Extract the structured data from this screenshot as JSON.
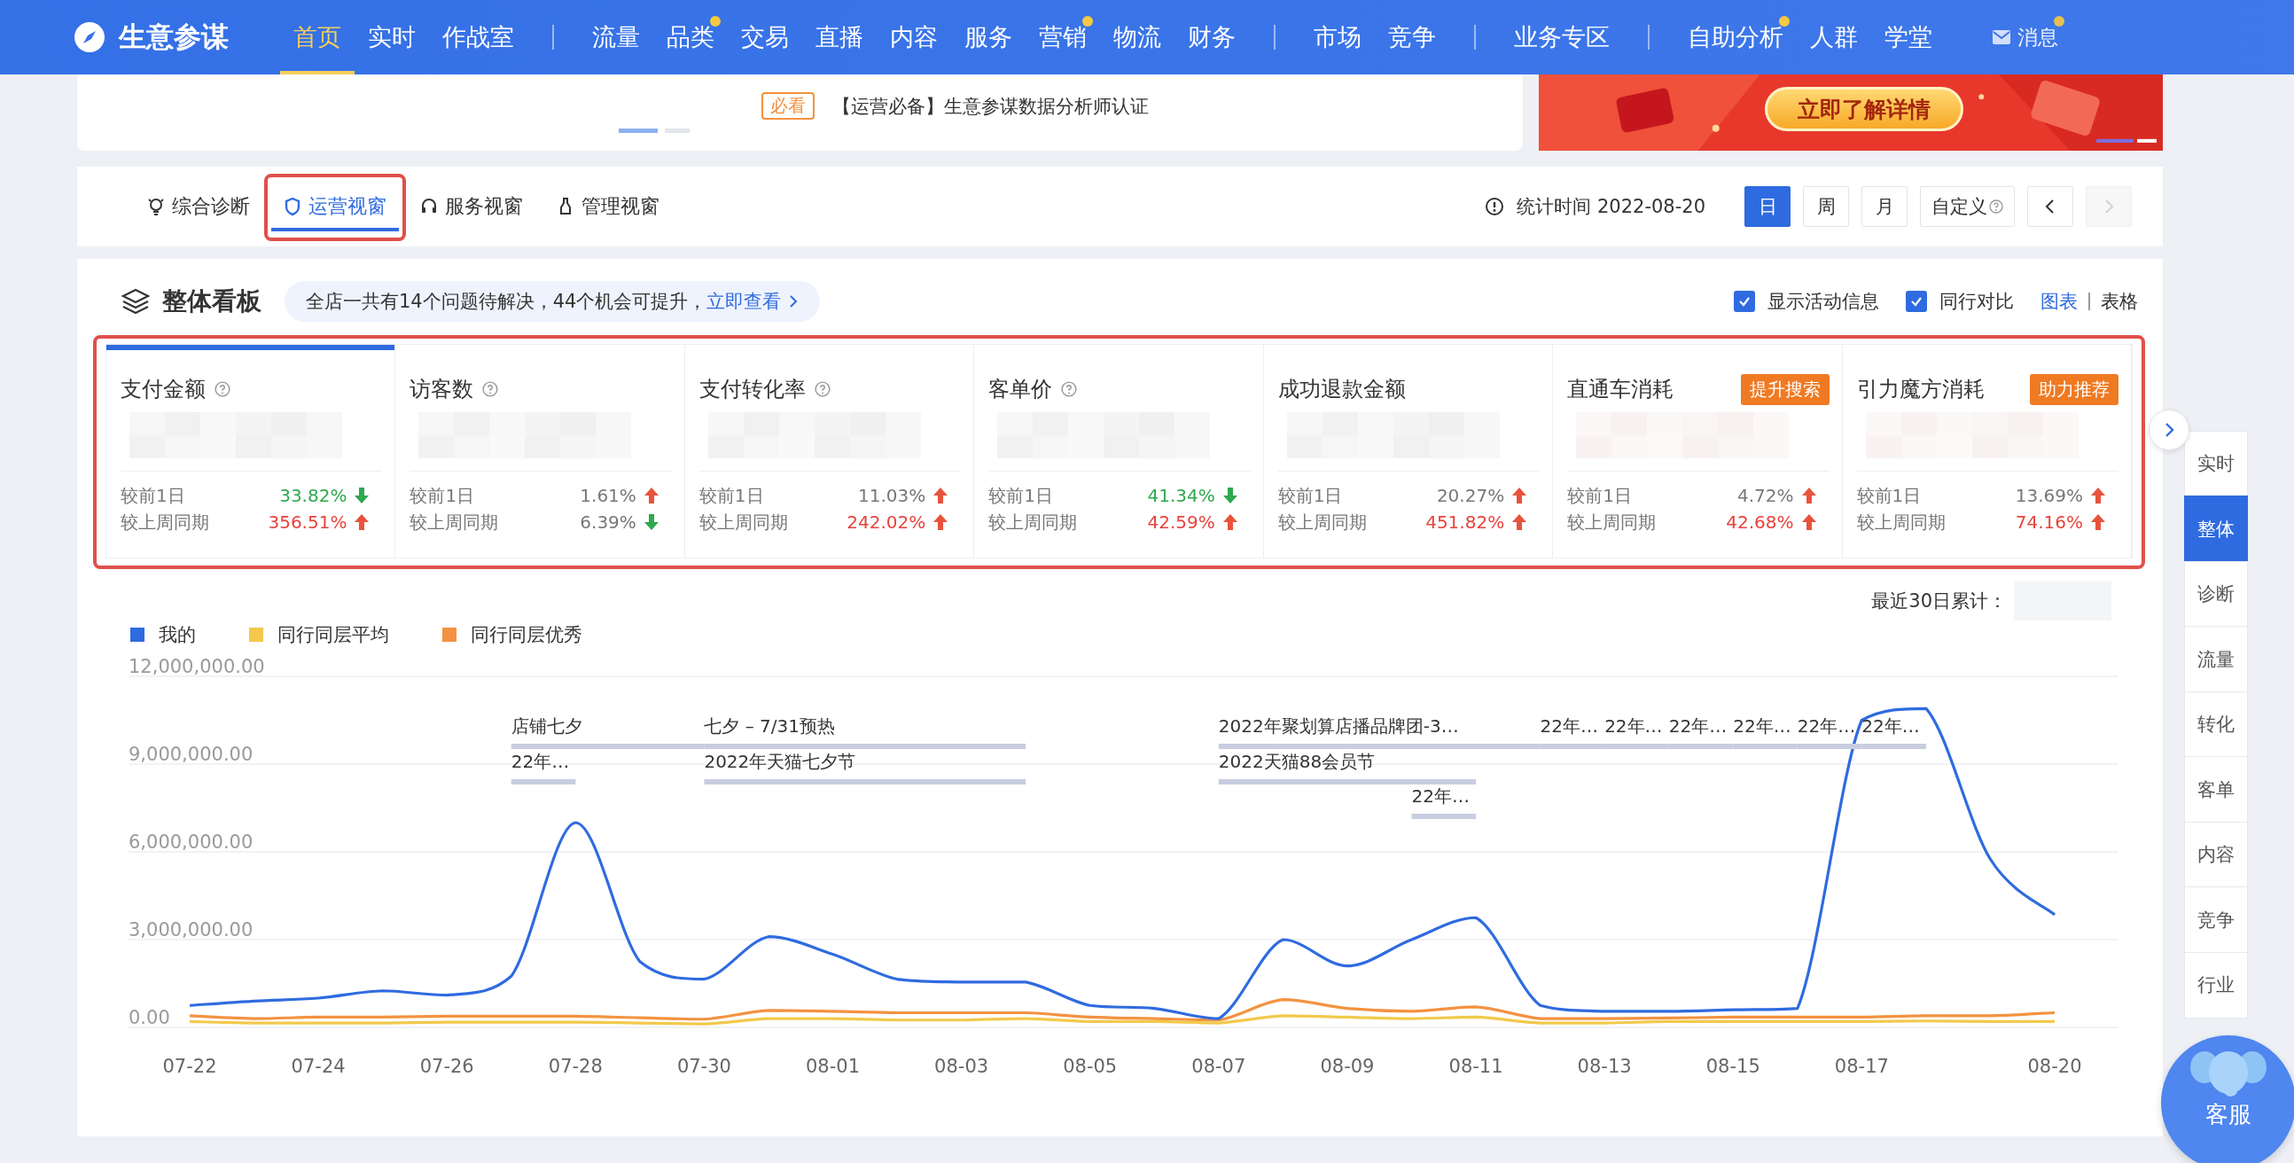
{
  "nav": {
    "logo": "生意参谋",
    "groups": [
      [
        {
          "label": "首页",
          "selected": true,
          "dot": false
        },
        {
          "label": "实时",
          "selected": false,
          "dot": false
        },
        {
          "label": "作战室",
          "selected": false,
          "dot": false
        }
      ],
      [
        {
          "label": "流量",
          "selected": false,
          "dot": false
        },
        {
          "label": "品类",
          "selected": false,
          "dot": true
        },
        {
          "label": "交易",
          "selected": false,
          "dot": false
        },
        {
          "label": "直播",
          "selected": false,
          "dot": false
        },
        {
          "label": "内容",
          "selected": false,
          "dot": false
        },
        {
          "label": "服务",
          "selected": false,
          "dot": false
        },
        {
          "label": "营销",
          "selected": false,
          "dot": true
        },
        {
          "label": "物流",
          "selected": false,
          "dot": false
        },
        {
          "label": "财务",
          "selected": false,
          "dot": false
        }
      ],
      [
        {
          "label": "市场",
          "selected": false,
          "dot": false
        },
        {
          "label": "竞争",
          "selected": false,
          "dot": false
        }
      ],
      [
        {
          "label": "业务专区",
          "selected": false,
          "dot": false
        }
      ],
      [
        {
          "label": "自助分析",
          "selected": false,
          "dot": true
        },
        {
          "label": "人群",
          "selected": false,
          "dot": false
        },
        {
          "label": "学堂",
          "selected": false,
          "dot": false
        }
      ]
    ],
    "messages": {
      "label": "消息",
      "dot": true
    }
  },
  "banner": {
    "tag": "必看",
    "text": "【运营必备】生意参谋数据分析师认证",
    "pager": [
      {
        "selected": true
      },
      {
        "selected": false
      }
    ],
    "ad_button": "立即了解详情"
  },
  "view_tabs": [
    {
      "label": "综合诊断",
      "selected": false,
      "highlighted": false
    },
    {
      "label": "运营视窗",
      "selected": true,
      "highlighted": true
    },
    {
      "label": "服务视窗",
      "selected": false,
      "highlighted": false
    },
    {
      "label": "管理视窗",
      "selected": false,
      "highlighted": false
    }
  ],
  "stat_time": "统计时间 2022-08-20",
  "periods": [
    {
      "label": "日",
      "selected": true,
      "help": false
    },
    {
      "label": "周",
      "selected": false,
      "help": false
    },
    {
      "label": "月",
      "selected": false,
      "help": false
    },
    {
      "label": "自定义",
      "selected": false,
      "help": true
    }
  ],
  "pager_buttons": [
    {
      "kind": "prev",
      "disabled": false
    },
    {
      "kind": "next",
      "disabled": true
    }
  ],
  "overview": {
    "title": "整体看板",
    "notice": "全店一共有14个问题待解决，44个机会可提升，",
    "notice_link": "立即查看",
    "options": [
      {
        "label": "显示活动信息",
        "checked": true
      },
      {
        "label": "同行对比",
        "checked": true
      }
    ],
    "views": [
      {
        "label": "图表",
        "selected": true
      },
      {
        "label": "表格",
        "selected": false
      }
    ],
    "metrics_highlighted": true,
    "metrics": [
      {
        "name": "支付金额",
        "help": true,
        "selected": true,
        "compare": [
          {
            "label": "较前1日",
            "value": "33.82%",
            "up": false,
            "color": "#2fa84f"
          },
          {
            "label": "较上周同期",
            "value": "356.51%",
            "up": true,
            "color": "#e8433c"
          }
        ]
      },
      {
        "name": "访客数",
        "help": true,
        "selected": false,
        "compare": [
          {
            "label": "较前1日",
            "value": "1.61%",
            "up": true,
            "color": "#777777"
          },
          {
            "label": "较上周同期",
            "value": "6.39%",
            "up": false,
            "color": "#777777"
          }
        ]
      },
      {
        "name": "支付转化率",
        "help": true,
        "selected": false,
        "compare": [
          {
            "label": "较前1日",
            "value": "11.03%",
            "up": true,
            "color": "#777777"
          },
          {
            "label": "较上周同期",
            "value": "242.02%",
            "up": true,
            "color": "#e8433c"
          }
        ]
      },
      {
        "name": "客单价",
        "help": true,
        "selected": false,
        "compare": [
          {
            "label": "较前1日",
            "value": "41.34%",
            "up": false,
            "color": "#2fa84f"
          },
          {
            "label": "较上周同期",
            "value": "42.59%",
            "up": true,
            "color": "#e8433c"
          }
        ]
      },
      {
        "name": "成功退款金额",
        "help": false,
        "selected": false,
        "compare": [
          {
            "label": "较前1日",
            "value": "20.27%",
            "up": true,
            "color": "#777777"
          },
          {
            "label": "较上周同期",
            "value": "451.82%",
            "up": true,
            "color": "#e8433c"
          }
        ]
      },
      {
        "name": "直通车消耗",
        "help": false,
        "selected": false,
        "badge": "提升搜索",
        "compare": [
          {
            "label": "较前1日",
            "value": "4.72%",
            "up": true,
            "color": "#777777"
          },
          {
            "label": "较上周同期",
            "value": "42.68%",
            "up": true,
            "color": "#e8433c"
          }
        ]
      },
      {
        "name": "引力魔方消耗",
        "help": false,
        "selected": false,
        "badge": "助力推荐",
        "compare": [
          {
            "label": "较前1日",
            "value": "13.69%",
            "up": true,
            "color": "#777777"
          },
          {
            "label": "较上周同期",
            "value": "74.16%",
            "up": true,
            "color": "#e8433c"
          }
        ]
      }
    ],
    "summary_label": "最近30日累计：",
    "chart_data": {
      "type": "line",
      "grid": true,
      "categories": [
        "07-22",
        null,
        "07-24",
        null,
        "07-26",
        null,
        "07-28",
        null,
        "07-30",
        null,
        "08-01",
        null,
        "08-03",
        null,
        "08-05",
        null,
        "08-07",
        null,
        "08-09",
        null,
        "08-11",
        null,
        "08-13",
        null,
        "08-15",
        null,
        "08-17",
        null,
        null,
        "08-20"
      ],
      "ylim": [
        0,
        12000000
      ],
      "yticks": [
        {
          "value": 0,
          "label": "0.00"
        },
        {
          "value": 3000000,
          "label": "3,000,000.00"
        },
        {
          "value": 6000000,
          "label": "6,000,000.00"
        },
        {
          "value": 9000000,
          "label": "9,000,000.00"
        },
        {
          "value": 12000000,
          "label": "12,000,000.00"
        }
      ],
      "series": [
        {
          "name": "我的",
          "color": "#2f6be0",
          "values": [
            750000,
            900000,
            1000000,
            1250000,
            1100000,
            1750000,
            7000000,
            2250000,
            1650000,
            3100000,
            2500000,
            1650000,
            1550000,
            1550000,
            750000,
            650000,
            300000,
            3000000,
            2100000,
            3000000,
            3750000,
            750000,
            550000,
            550000,
            600000,
            650000,
            10500000,
            10900000,
            5750000,
            3850000
          ]
        },
        {
          "name": "同行同层平均",
          "color": "#f2c94c",
          "values": [
            200000,
            150000,
            150000,
            150000,
            180000,
            180000,
            180000,
            150000,
            120000,
            300000,
            300000,
            250000,
            250000,
            300000,
            200000,
            200000,
            150000,
            400000,
            350000,
            300000,
            350000,
            150000,
            150000,
            200000,
            200000,
            200000,
            200000,
            220000,
            200000,
            200000
          ]
        },
        {
          "name": "同行同层优秀",
          "color": "#f39240",
          "values": [
            400000,
            300000,
            350000,
            350000,
            380000,
            380000,
            380000,
            330000,
            280000,
            580000,
            550000,
            500000,
            500000,
            500000,
            350000,
            300000,
            250000,
            950000,
            650000,
            550000,
            700000,
            300000,
            300000,
            320000,
            350000,
            350000,
            350000,
            400000,
            400000,
            500000
          ]
        }
      ]
    },
    "events": [
      {
        "text": "店铺七夕"
      },
      {
        "text": "七夕 – 7/31预热"
      },
      {
        "text": "2022年聚划算店播品牌团-3…"
      },
      {
        "text": "22年…"
      },
      {
        "text": "22年…"
      },
      {
        "text": "22年…"
      },
      {
        "text": "22年…"
      },
      {
        "text": "22年…"
      },
      {
        "text": "22年…"
      },
      {
        "text": "22年…"
      },
      {
        "text": "2022年天猫七夕节"
      },
      {
        "text": "2022天猫88会员节"
      },
      {
        "text": "22年…"
      }
    ]
  },
  "side_nav": [
    {
      "label": "实时",
      "selected": false
    },
    {
      "label": "整体",
      "selected": true
    },
    {
      "label": "诊断",
      "selected": false
    },
    {
      "label": "流量",
      "selected": false
    },
    {
      "label": "转化",
      "selected": false
    },
    {
      "label": "客单",
      "selected": false
    },
    {
      "label": "内容",
      "selected": false
    },
    {
      "label": "竞争",
      "selected": false
    },
    {
      "label": "行业",
      "selected": false
    }
  ],
  "service_button": "客服"
}
